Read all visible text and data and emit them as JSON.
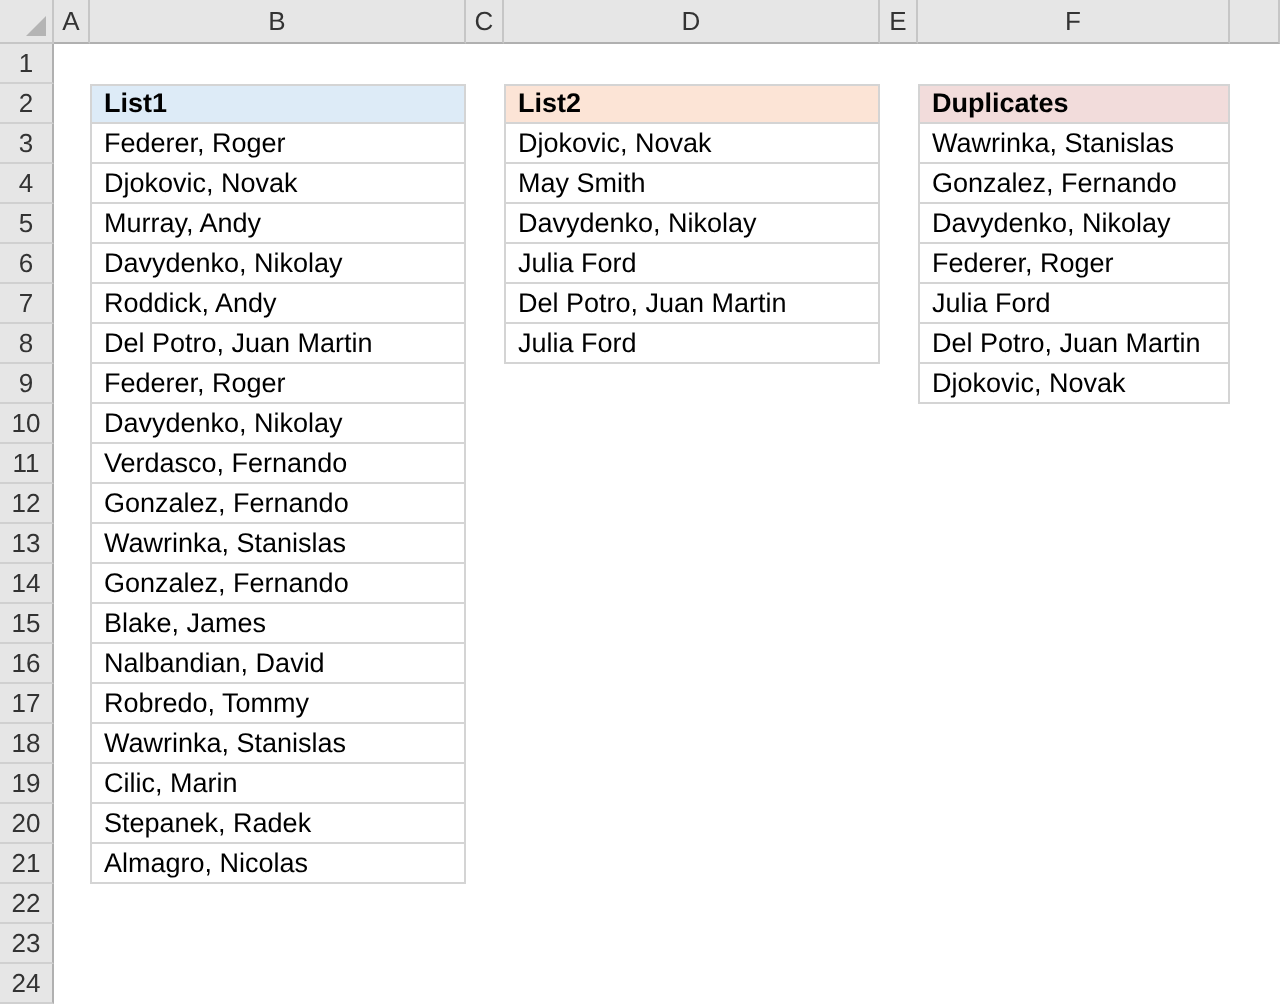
{
  "columns": [
    "A",
    "B",
    "C",
    "D",
    "E",
    "F"
  ],
  "rows": [
    "1",
    "2",
    "3",
    "4",
    "5",
    "6",
    "7",
    "8",
    "9",
    "10",
    "11",
    "12",
    "13",
    "14",
    "15",
    "16",
    "17",
    "18",
    "19",
    "20",
    "21",
    "22",
    "23",
    "24"
  ],
  "tables": [
    {
      "header": "List1",
      "color": "#ddebf7",
      "items": [
        "Federer, Roger",
        "Djokovic, Novak",
        "Murray, Andy",
        "Davydenko, Nikolay",
        "Roddick, Andy",
        "Del Potro, Juan Martin",
        "Federer, Roger",
        "Davydenko, Nikolay",
        "Verdasco, Fernando",
        "Gonzalez, Fernando",
        "Wawrinka, Stanislas",
        "Gonzalez, Fernando",
        "Blake, James",
        "Nalbandian, David",
        "Robredo, Tommy",
        "Wawrinka, Stanislas",
        "Cilic, Marin",
        "Stepanek, Radek",
        "Almagro, Nicolas"
      ]
    },
    {
      "header": "List2",
      "color": "#fce4d6",
      "items": [
        "Djokovic, Novak",
        "May Smith",
        "Davydenko, Nikolay",
        "Julia Ford",
        "Del Potro, Juan Martin",
        "Julia Ford"
      ]
    },
    {
      "header": "Duplicates",
      "color": "#f2dcdb",
      "items": [
        "Wawrinka, Stanislas",
        "Gonzalez, Fernando",
        "Davydenko, Nikolay",
        "Federer, Roger",
        "Julia Ford",
        "Del Potro, Juan Martin",
        "Djokovic, Novak"
      ]
    }
  ]
}
